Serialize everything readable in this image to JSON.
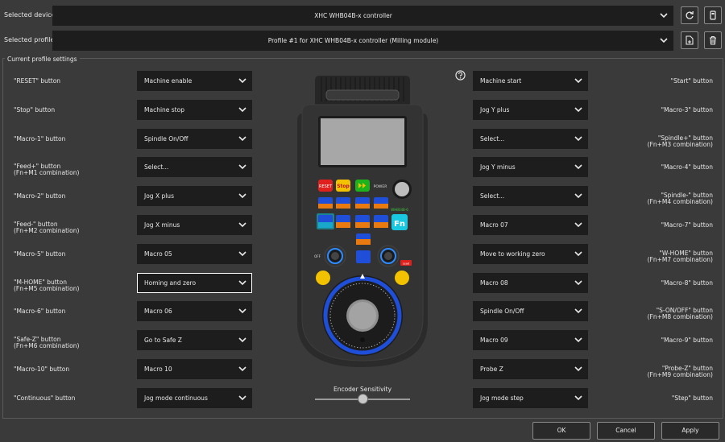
{
  "device": {
    "label": "Selected device",
    "value": "XHC WHB04B-x controller"
  },
  "profile": {
    "label": "Selected profile",
    "value": "Profile #1 for XHC WHB04B-x controller (Milling module)"
  },
  "group_title": "Current profile settings",
  "left_rows": [
    {
      "label1": "\"RESET\" button",
      "label2": "",
      "value": "Machine enable"
    },
    {
      "label1": "\"Stop\" button",
      "label2": "",
      "value": "Machine stop"
    },
    {
      "label1": "\"Macro-1\" button",
      "label2": "",
      "value": "Spindle On/Off"
    },
    {
      "label1": "\"Feed+\" button",
      "label2": "(Fn+M1 combination)",
      "value": "Select..."
    },
    {
      "label1": "\"Macro-2\" button",
      "label2": "",
      "value": "Jog X plus"
    },
    {
      "label1": "\"Feed-\" button",
      "label2": "(Fn+M2 combination)",
      "value": "Jog X minus"
    },
    {
      "label1": "\"Macro-5\" button",
      "label2": "",
      "value": "Macro 05"
    },
    {
      "label1": "\"M-HOME\" button",
      "label2": "(Fn+M5 combination)",
      "value": "Homing and zero"
    },
    {
      "label1": "\"Macro-6\" button",
      "label2": "",
      "value": "Macro 06"
    },
    {
      "label1": "\"Safe-Z\" button",
      "label2": "(Fn+M6 combination)",
      "value": "Go to Safe Z"
    },
    {
      "label1": "\"Macro-10\" button",
      "label2": "",
      "value": "Macro 10"
    },
    {
      "label1": "\"Continuous\" button",
      "label2": "",
      "value": "Jog mode continuous"
    }
  ],
  "right_rows": [
    {
      "label1": "\"Start\" button",
      "label2": "",
      "value": "Machine start"
    },
    {
      "label1": "\"Macro-3\" button",
      "label2": "",
      "value": "Jog Y plus"
    },
    {
      "label1": "\"Spindle+\" button",
      "label2": "(Fn+M3 combination)",
      "value": "Select..."
    },
    {
      "label1": "\"Macro-4\" button",
      "label2": "",
      "value": "Jog Y minus"
    },
    {
      "label1": "\"Spindle-\" button",
      "label2": "(Fn+M4 combination)",
      "value": "Select..."
    },
    {
      "label1": "\"Macro-7\" button",
      "label2": "",
      "value": "Macro 07"
    },
    {
      "label1": "\"W-HOME\" button",
      "label2": "(Fn+M7 combination)",
      "value": "Move to working zero"
    },
    {
      "label1": "\"Macro-8\" button",
      "label2": "",
      "value": "Macro 08"
    },
    {
      "label1": "\"S-ON/OFF\" button",
      "label2": "(Fn+M8 combination)",
      "value": "Spindle On/Off"
    },
    {
      "label1": "\"Macro-9\" button",
      "label2": "",
      "value": "Macro 09"
    },
    {
      "label1": "\"Probe-Z\" button",
      "label2": "(Fn+M9 combination)",
      "value": "Probe Z"
    },
    {
      "label1": "\"Step\" button",
      "label2": "",
      "value": "Jog mode step"
    }
  ],
  "pendant": {
    "reset": "RESET",
    "stop": "Stop",
    "power": "POWER",
    "model": "WHB04B-6",
    "fn": "Fn",
    "macros_row1": [
      "Macro-1",
      "Macro-2",
      "Macro-3",
      "Macro-4"
    ],
    "macros_row1_sub": [
      "Feed+",
      "Feed-",
      "Spindle+",
      "Spindle-"
    ],
    "macros_row2": [
      "Macro-5",
      "Macro-6",
      "Macro-7",
      "Macro-8"
    ],
    "macros_row2_sub": [
      "M-HOME",
      "Safe-Z",
      "W-HOME",
      "S-ON/OFF"
    ],
    "macro9": "Macro-9",
    "macro9_sub": "Probe-Z",
    "macro10": "Macro-10",
    "continuous": "Continuous",
    "step": "Step",
    "off": "OFF",
    "lead": "Lead"
  },
  "encoder": {
    "label": "Encoder Sensitivity",
    "value": 0.5
  },
  "buttons": {
    "ok": "OK",
    "cancel": "Cancel",
    "apply": "Apply"
  },
  "icons": [
    "chevron-down-icon",
    "refresh-icon",
    "device-icon",
    "save-profile-icon",
    "delete-icon",
    "help-icon"
  ]
}
